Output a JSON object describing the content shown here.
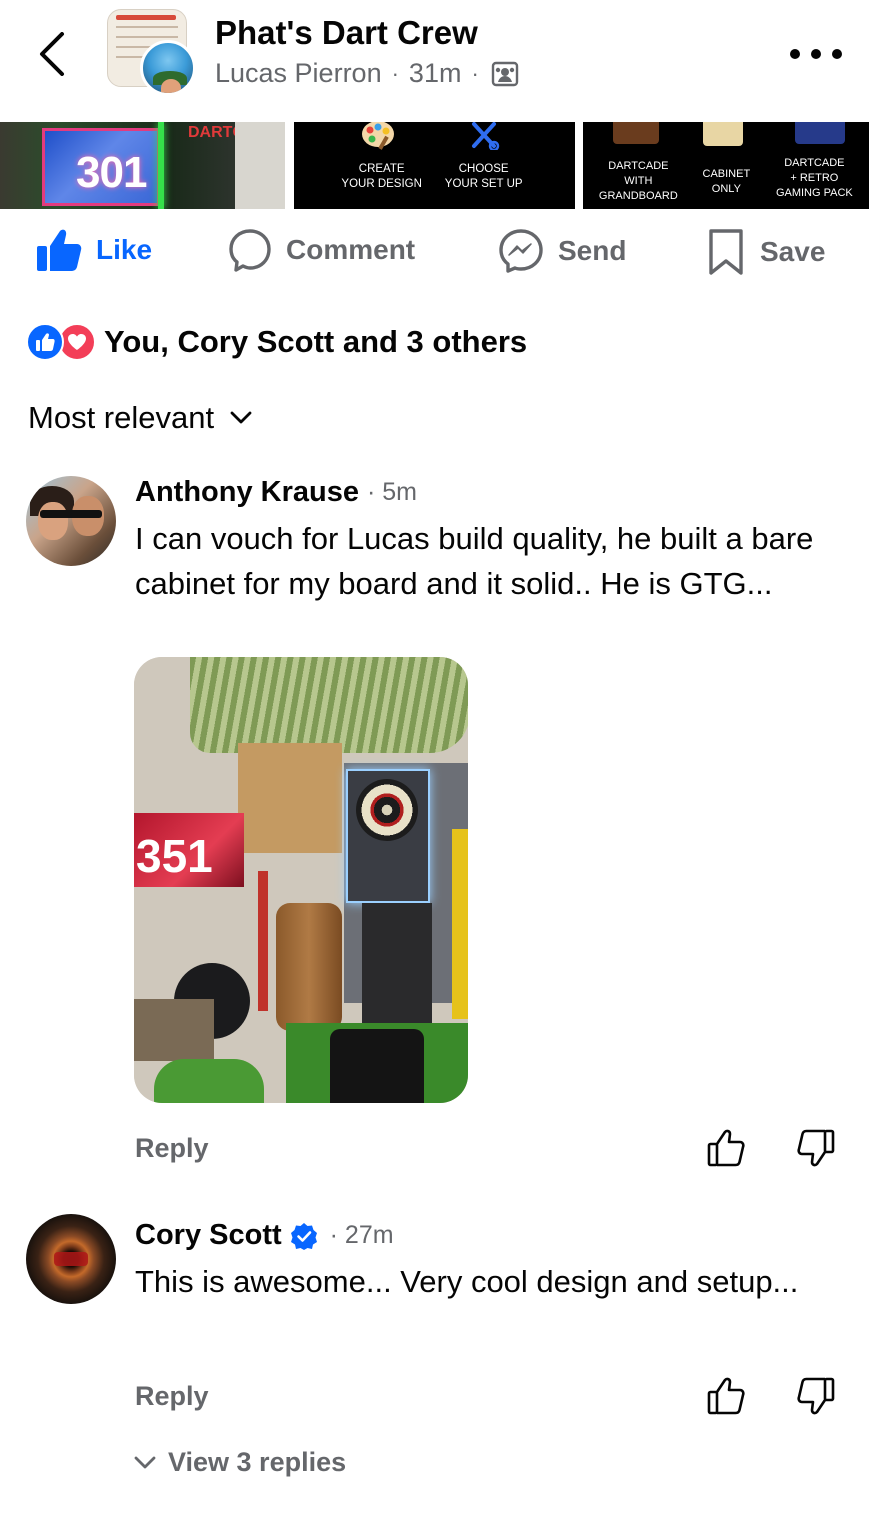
{
  "header": {
    "group_name": "Phat's Dart Crew",
    "author": "Lucas Pierron",
    "separator": "·",
    "time": "31m",
    "icons": {
      "back": "chevron-left-icon",
      "privacy": "group-members-icon",
      "more": "more-horizontal-icon"
    }
  },
  "carousel": {
    "card1": {
      "screen_value": "301",
      "logo_text": "DARTCADE"
    },
    "card2": {
      "options": [
        {
          "line1": "CREATE",
          "line2": "YOUR DESIGN",
          "icon": "palette-icon"
        },
        {
          "line1": "CHOOSE",
          "line2": "YOUR SET UP",
          "icon": "tools-icon"
        }
      ]
    },
    "card3": {
      "options": [
        {
          "line1": "DARTCADE",
          "line2": "WITH",
          "line3": "GRANDBOARD"
        },
        {
          "line1": "CABINET",
          "line2": "ONLY"
        },
        {
          "line1": "DARTCADE",
          "line2": "+ RETRO",
          "line3": "GAMING PACK"
        }
      ]
    }
  },
  "actions": {
    "like": "Like",
    "comment": "Comment",
    "send": "Send",
    "save": "Save"
  },
  "reactions": {
    "summary": "You, Cory Scott and 3 others",
    "types": [
      "like-icon",
      "love-icon"
    ]
  },
  "sort": {
    "label": "Most relevant"
  },
  "comments": [
    {
      "author": "Anthony Krause",
      "time": "· 5m",
      "text": "I can vouch for Lucas build quality, he built a bare cabinet for my board and it solid.. He is GTG...",
      "has_photo": true,
      "photo_screen_value": "351",
      "reply_label": "Reply"
    },
    {
      "author": "Cory Scott",
      "verified": true,
      "time": "· 27m",
      "text": "This is awesome... Very cool design and setup...",
      "reply_label": "Reply",
      "view_replies": "View 3 replies"
    }
  ],
  "colors": {
    "accent_blue": "#0866ff",
    "love_red": "#f33e58",
    "secondary_text": "#65676b",
    "primary_text": "#050505"
  }
}
